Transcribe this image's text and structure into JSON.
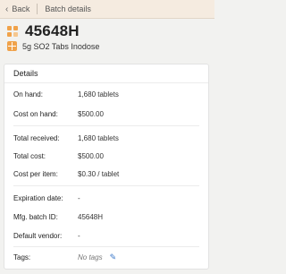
{
  "nav": {
    "back_label": "Back",
    "breadcrumb": "Batch details"
  },
  "page": {
    "title": "45648H",
    "product": "5g SO2 Tabs Inodose"
  },
  "details": {
    "header": "Details",
    "on_hand_label": "On hand:",
    "on_hand": "1,680 tablets",
    "cost_on_hand_label": "Cost on hand:",
    "cost_on_hand": "$500.00",
    "total_received_label": "Total received:",
    "total_received": "1,680 tablets",
    "total_cost_label": "Total cost:",
    "total_cost": "$500.00",
    "cost_per_item_label": "Cost per item:",
    "cost_per_item": "$0.30 / tablet",
    "expiration_label": "Expiration date:",
    "expiration": "-",
    "mfg_batch_label": "Mfg. batch ID:",
    "mfg_batch": "45648H",
    "default_vendor_label": "Default vendor:",
    "default_vendor": "-",
    "tags_label": "Tags:",
    "tags": "No tags"
  },
  "colors": {
    "accent": "#f0a24a",
    "topbar": "#f5ebe0",
    "link": "#3a78c9"
  },
  "icons": {
    "back": "chevron-left-icon",
    "logo": "grid-icon",
    "product": "plus-square-icon",
    "edit": "pencil-icon"
  }
}
